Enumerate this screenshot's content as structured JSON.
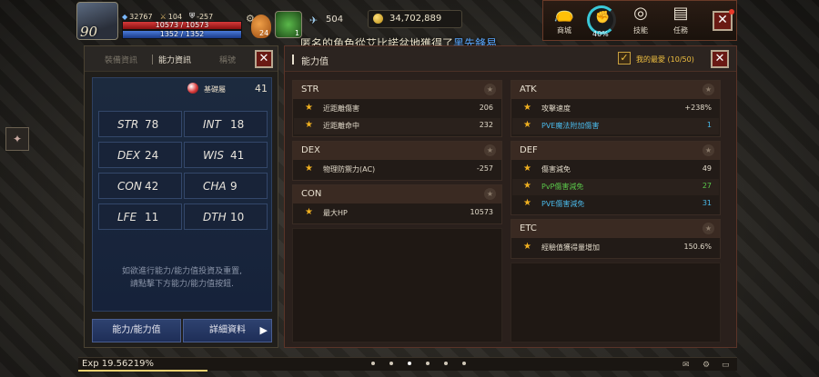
{
  "hud": {
    "level": "90",
    "stat_a": "32767",
    "stat_b": "104",
    "stat_c": "-257",
    "hp_text": "10573 / 10573",
    "mp_text": "1352 / 1352",
    "potion_count": "24",
    "herb_count": "1",
    "wing_count": "504",
    "gold": "34,702,889",
    "chat_prefix": "匿名的角色從艾比諾盆地獲得了",
    "chat_item": "黑先鋒易"
  },
  "top_menu": {
    "shop_label": "商城",
    "progress_label": "40%",
    "progress": 0.4,
    "skill_label": "技能",
    "quest_label": "任務"
  },
  "left_panel": {
    "tabs": [
      "裝備資訊",
      "能力資訊",
      "稱號"
    ],
    "attr_label": "基礎屬",
    "attr_value": "41",
    "stats": [
      {
        "name": "STR",
        "value": "78"
      },
      {
        "name": "INT",
        "value": "18"
      },
      {
        "name": "DEX",
        "value": "24"
      },
      {
        "name": "WIS",
        "value": "41"
      },
      {
        "name": "CON",
        "value": "42"
      },
      {
        "name": "CHA",
        "value": "9"
      },
      {
        "name": "LFE",
        "value": "11"
      },
      {
        "name": "DTH",
        "value": "10"
      }
    ],
    "note_line1": "如欲進行能力/能力值投資及重置,",
    "note_line2": "請點擊下方能力/能力值按鈕.",
    "button_left": "能力/能力值",
    "button_right": "詳細資料"
  },
  "right_panel": {
    "title": "能力值",
    "favorites_label": "我的最愛 (10/50)",
    "sections": {
      "str": {
        "title": "STR",
        "rows": [
          {
            "label": "近距離傷害",
            "value": "206"
          },
          {
            "label": "近距離命中",
            "value": "232"
          }
        ]
      },
      "dex": {
        "title": "DEX",
        "rows": [
          {
            "label": "物理防禦力(AC)",
            "value": "-257"
          }
        ]
      },
      "con": {
        "title": "CON",
        "rows": [
          {
            "label": "最大HP",
            "value": "10573"
          }
        ]
      },
      "atk": {
        "title": "ATK",
        "rows": [
          {
            "label": "攻擊速度",
            "value": "+238%"
          },
          {
            "label": "PVE魔法附加傷害",
            "value": "1"
          }
        ]
      },
      "def": {
        "title": "DEF",
        "rows": [
          {
            "label": "傷害減免",
            "value": "49"
          },
          {
            "label": "PvP傷害減免",
            "value": "27"
          },
          {
            "label": "PVE傷害減免",
            "value": "31"
          }
        ]
      },
      "etc": {
        "title": "ETC",
        "rows": [
          {
            "label": "經驗值獲得量增加",
            "value": "150.6%"
          }
        ]
      }
    }
  },
  "exp": {
    "label": "Exp",
    "value": "19.56219%",
    "fraction": 0.1956
  },
  "colors": {
    "accent_red": "#6a1a14",
    "gold_star": "#f0b020",
    "panel_blue": "#1c2a3e"
  }
}
